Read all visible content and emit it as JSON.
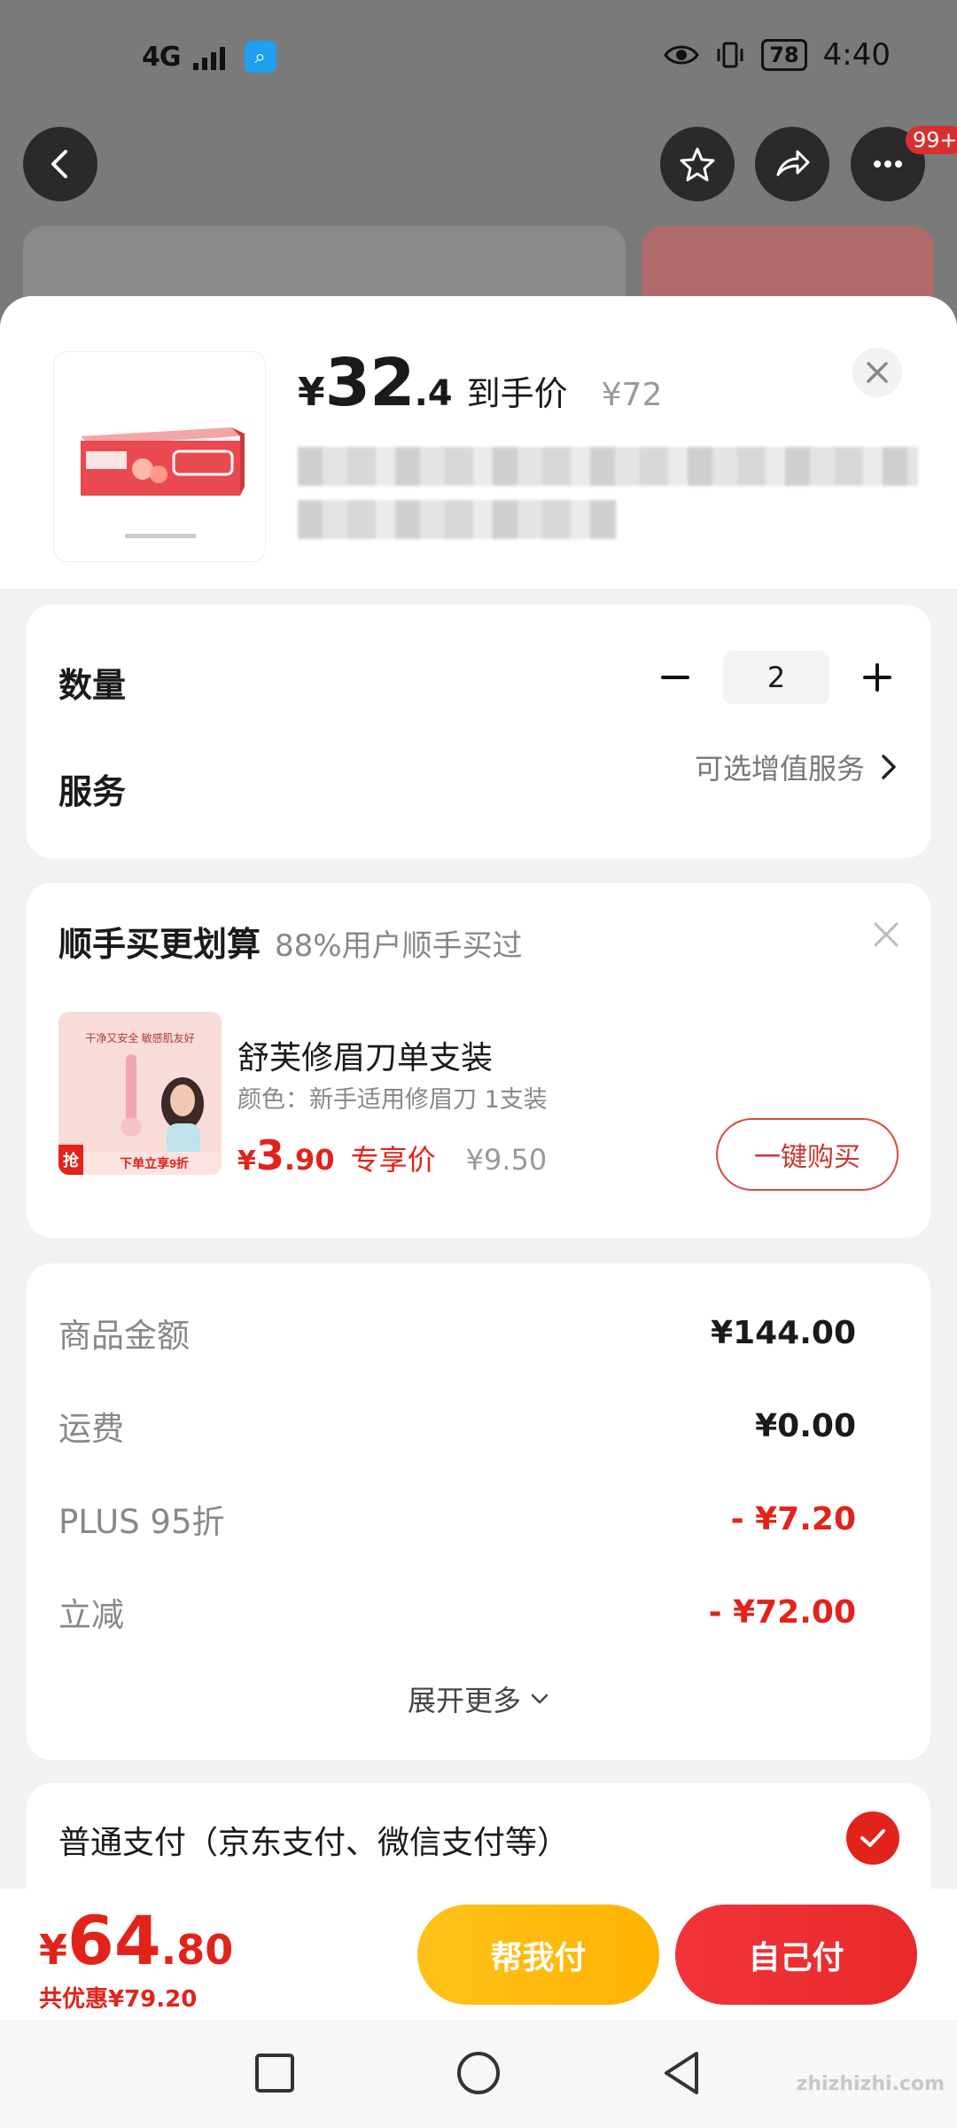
{
  "status_bar": {
    "network": "4G",
    "battery": "78",
    "time": "4:40"
  },
  "background_page": {
    "badge": "99+"
  },
  "product": {
    "price_symbol": "¥",
    "price_int": "32",
    "price_dec": ".4",
    "price_tag": "到手价",
    "original_price": "¥72"
  },
  "quantity_card": {
    "quantity_label": "数量",
    "quantity_value": "2",
    "service_label": "服务",
    "service_value": "可选增值服务"
  },
  "addon": {
    "title": "顺手买更划算",
    "subtitle": "88%用户顺手买过",
    "name": "舒芙修眉刀单支装",
    "spec": "颜色：新手适用修眉刀 1支装",
    "price_symbol": "¥",
    "price_int": "3",
    "price_dec": ".90",
    "price_tag": "专享价",
    "original_price": "¥9.50",
    "buy_label": "一键购买",
    "image_badge": "抢",
    "image_banner": "下单立享9折",
    "image_caption": "干净又安全 敏感肌友好"
  },
  "summary": {
    "rows": [
      {
        "label": "商品金额",
        "value": "¥144.00",
        "red": false
      },
      {
        "label": "运费",
        "value": "¥0.00",
        "red": false
      },
      {
        "label": "PLUS 95折",
        "value": "- ¥7.20",
        "red": true
      },
      {
        "label": "立减",
        "value": "- ¥72.00",
        "red": true
      }
    ],
    "expand_label": "展开更多"
  },
  "payment": {
    "label": "普通支付（京东支付、微信支付等）"
  },
  "action_bar": {
    "total_symbol": "¥",
    "total_int": "64",
    "total_dec": ".80",
    "saving": "共优惠¥79.20",
    "help_pay": "帮我付",
    "self_pay": "自己付"
  },
  "colors": {
    "accent_red": "#e2231a",
    "help_yellow": "#ffc21a"
  },
  "watermark": "zhizhizhi.com"
}
